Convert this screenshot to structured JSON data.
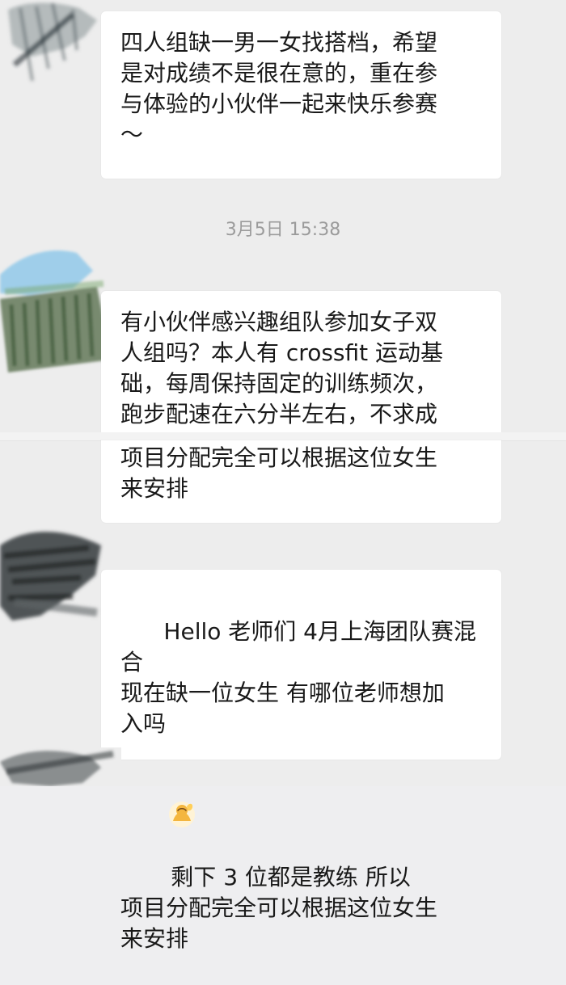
{
  "chat": {
    "messages": [
      {
        "text": "四人组缺一男一女找搭档，希望\n是对成绩不是很在意的，重在参\n与体验的小伙伴一起来快乐参赛\n～"
      },
      {
        "timestamp": "3月5日 15:38"
      },
      {
        "text_top": "有小伙伴感兴趣组队参加女子双\n人组吗？本人有 crossfit 运动基\n础，每周保持固定的训练频次，\n跑步配速在六分半左右，不求成",
        "text_bottom": "项目分配完全可以根据这位女生\n来安排"
      },
      {
        "text": "Hello 老师们 4月上海团队赛混合\n现在缺一位女生 有哪位老师想加\n入吗",
        "text_after_emoji": " 剩下 3 位都是教练 所以\n项目分配完全可以根据这位女生\n来安排"
      }
    ]
  },
  "emoji": {
    "name": "person-raising-hand-emoji",
    "color": "#f4b63f"
  }
}
